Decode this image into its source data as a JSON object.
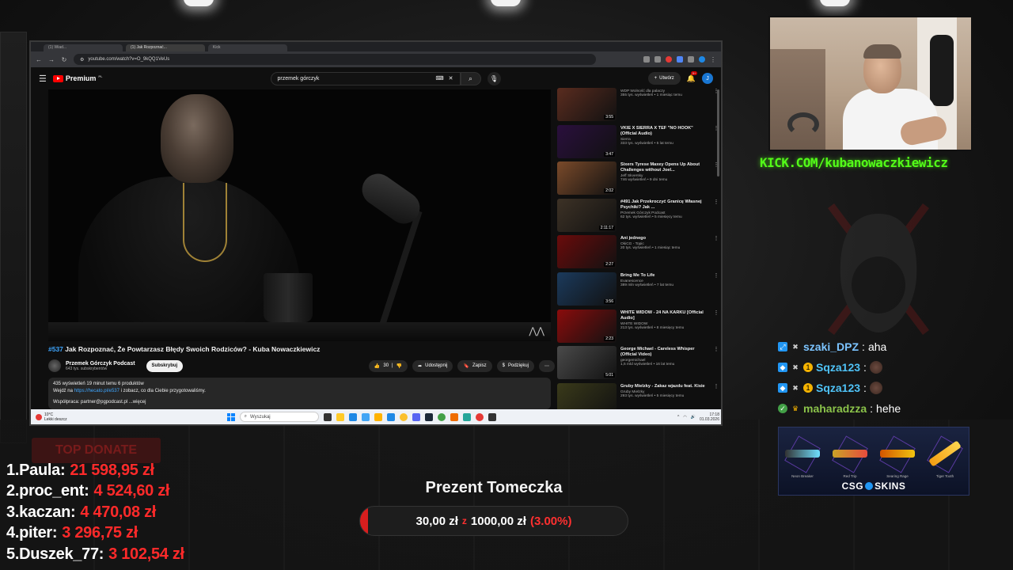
{
  "browser": {
    "tabs": [
      "(1) Wiad...",
      "(1) Jak Rozpoznać...",
      "Kick"
    ],
    "url": "youtube.com/watch?v=O_9kQQ1VeUs"
  },
  "youtube": {
    "logo": "Premium",
    "logo_sup": "PL",
    "search_value": "przemek górczyk",
    "create_label": "Utwórz",
    "notif_count": "9+",
    "avatar_letter": "J"
  },
  "video": {
    "episode": "#537",
    "title": "Jak Rozpoznać, Że Powtarzasz Błędy Swoich Rodziców? - Kuba Nowaczkiewicz",
    "channel": "Przemek Górczyk Podcast",
    "subscribers": "643 tys. subskrybentów",
    "subscribe_label": "Subskrybuj",
    "likes": "30",
    "share_label": "Udostępnij",
    "save_label": "Zapisz",
    "thanks_label": "Podziękuj",
    "desc_line1": "435 wyświetleń  19 minut temu  6 produktów",
    "desc_line2_pre": "Wejdź na ",
    "desc_link": "https://hecato.pl/e537",
    "desc_line2_post": " i zobacz, co dla Ciebie przygotowaliśmy.",
    "desc_line3": "Współpraca: partner@pgpodcast.pl ...więcej"
  },
  "recommendations": [
    {
      "title": "",
      "channel": "WDP Wolność dla palaczy",
      "meta": "355 tys. wyświetleń • 1 miesiąc temu",
      "duration": "3:55",
      "color": "#5a2c1f"
    },
    {
      "title": "VKIE X SIERRA X TEF \"NO HOOK\" (Official Audio)",
      "channel": "Sierra",
      "meta": "333 tys. wyświetleń • 5 lat temu",
      "duration": "3:47",
      "color": "#2a0f3d"
    },
    {
      "title": "Sixers Tyrese Maxey Opens Up About Challenges without Joel...",
      "channel": "Jeff Skversky",
      "meta": "746 wyświetleń • 9 dni temu",
      "duration": "2:02",
      "color": "#7a4a2a"
    },
    {
      "title": "#491 Jak Przekroczyć Granicę Własnej Psychiki? Jak ...",
      "channel": "Przemek Górczyk Podcast",
      "meta": "62 tys. wyświetleń • 5 miesięcy temu",
      "duration": "2:11:17",
      "color": "#3d3226"
    },
    {
      "title": "Ani jednego",
      "channel": "OkiCG - Topic",
      "meta": "20 tys. wyświetleń • 1 miesiąc temu",
      "duration": "2:27",
      "color": "#6a0b0b"
    },
    {
      "title": "Bring Me To Life",
      "channel": "Evanescence",
      "meta": "389 mln wyświetleń • 7 lat temu",
      "duration": "3:56",
      "color": "#1b3a5c"
    },
    {
      "title": "WHITE WIDOW - 24 NA KARKU [Official Audio]",
      "channel": "WHITE WIDOW",
      "meta": "213 tys. wyświetleń • 8 miesięcy temu",
      "duration": "2:23",
      "color": "#8a0c0c"
    },
    {
      "title": "George Michael - Careless Whisper (Official Video)",
      "channel": "georgemichael",
      "meta": "1,5 mld wyświetleń • 16 lat temu",
      "duration": "5:01",
      "color": "#4a4a4a"
    },
    {
      "title": "Gruby Mielzky - Zakaz wjazdu feat. Kisie",
      "channel": "Gruby Mielzky",
      "meta": "293 tys. wyświetleń • 5 miesięcy temu",
      "duration": "3:38",
      "color": "#3a3a1a"
    }
  ],
  "taskbar": {
    "temp": "10°C",
    "weather": "Lekki deszcz",
    "search_label": "Wyszukaj",
    "time": "17:18",
    "date": "01.03.2026"
  },
  "stream": {
    "kick_url": "KICK.COM/kubanowaczkiewicz"
  },
  "chat": [
    {
      "user": "szaki_DPZ",
      "text": "aha"
    },
    {
      "user": "Sqza123",
      "text": ""
    },
    {
      "user": "Sqza123",
      "text": ""
    },
    {
      "user": "maharadzza",
      "text": "hehe"
    }
  ],
  "skins": {
    "brand_pre": "CSG",
    "brand_post": "SKINS",
    "items": [
      "Neon Breaker",
      "Red Trip",
      "Searing Rage",
      "Tiger Tooth"
    ]
  },
  "donations": {
    "header": "TOP DONATE",
    "rows": [
      {
        "name": "1.Paula:",
        "amount": "21 598,95 zł"
      },
      {
        "name": "2.proc_ent:",
        "amount": "4 524,60 zł"
      },
      {
        "name": "3.kaczan:",
        "amount": "4 470,08 zł"
      },
      {
        "name": "4.piter:",
        "amount": "3 296,75 zł"
      },
      {
        "name": "5.Duszek_77:",
        "amount": "3 102,54 zł"
      }
    ]
  },
  "gift_goal": {
    "title": "Prezent Tomeczka",
    "current": "30,00 zł",
    "separator": "z",
    "target": "1000,00 zł",
    "percent": "(3.00%)",
    "progress_fraction": 0.03
  },
  "colors": {
    "kick_green": "#53fc18",
    "donate_red": "#ff2a2a",
    "yt_red": "#ff0000"
  }
}
